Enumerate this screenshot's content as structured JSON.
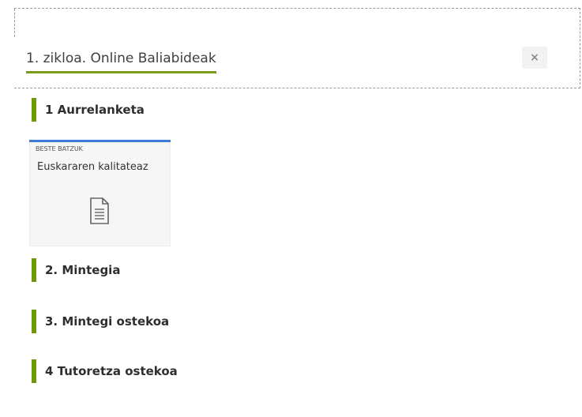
{
  "modal": {
    "title": "1. zikloa. Online Baliabideak",
    "close_label": "×",
    "accent_color": "#7a9a1a"
  },
  "sections": [
    {
      "label": "1 Aurrelanketa"
    },
    {
      "label": "2. Mintegia"
    },
    {
      "label": "3. Mintegi ostekoa"
    },
    {
      "label": "4 Tutoretza ostekoa"
    }
  ],
  "resource_card": {
    "category": "BESTE BATZUK",
    "title": "Euskararen kalitateaz",
    "icon": "document-icon",
    "top_border_color": "#3b7dd8"
  },
  "colors": {
    "section_bar": "#6e9a0a"
  }
}
